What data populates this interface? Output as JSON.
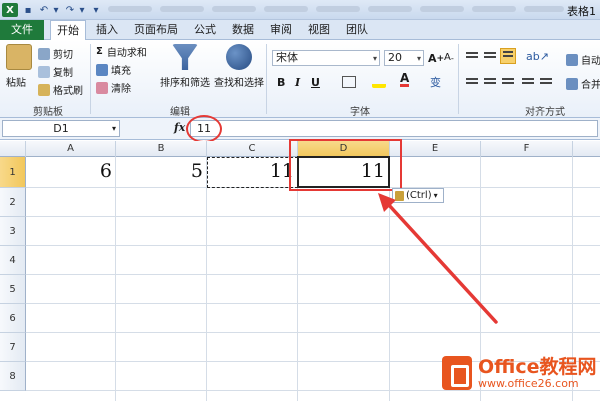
{
  "title_bar": {
    "title": "表格1"
  },
  "tabs": [
    "文件",
    "开始",
    "插入",
    "页面布局",
    "公式",
    "数据",
    "审阅",
    "视图",
    "团队"
  ],
  "ribbon": {
    "clipboard": {
      "paste": "粘贴",
      "cut": "剪切",
      "copy": "复制",
      "format_painter": "格式刷",
      "label": "剪贴板"
    },
    "editing": {
      "autosum": "自动求和",
      "fill": "填充",
      "clear": "清除",
      "sort_filter": "排序和筛选",
      "find_select": "查找和选择",
      "label": "编辑"
    },
    "font": {
      "font_name": "宋体",
      "font_size": "20",
      "bold": "B",
      "italic": "I",
      "underline": "U",
      "phonetic": "变",
      "label": "字体"
    },
    "alignment": {
      "merge": "合并",
      "wrap": "自动",
      "label": "对齐方式"
    }
  },
  "formula_bar": {
    "name_box": "D1",
    "fx": "fx",
    "value": "11"
  },
  "grid": {
    "columns": [
      "A",
      "B",
      "C",
      "D",
      "E",
      "F"
    ],
    "selected_column": "D",
    "rows": [
      "1",
      "2",
      "3",
      "4",
      "5",
      "6",
      "7",
      "8"
    ],
    "selected_row": "1",
    "row1": {
      "A": "6",
      "B": "5",
      "C": "11",
      "D": "11"
    }
  },
  "paste_options": {
    "label": "(Ctrl)"
  },
  "watermark": {
    "line1": "Office教程网",
    "line2": "www.office26.com"
  },
  "colors": {
    "file_tab": "#1f7a3b",
    "annotation_red": "#e53935",
    "selection": "#f2c75b",
    "watermark": "#e8551f"
  }
}
